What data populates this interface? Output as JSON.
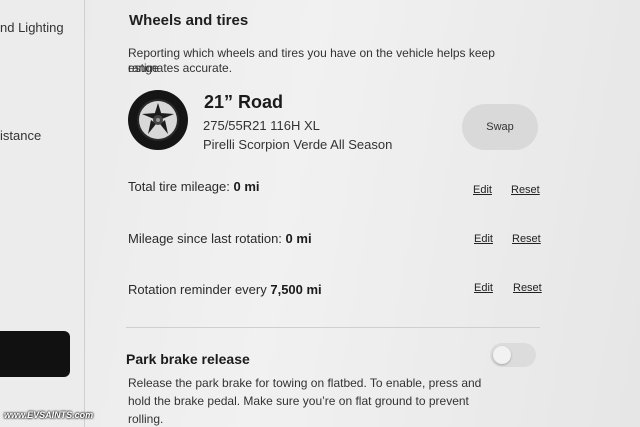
{
  "sidebar": {
    "items": [
      {
        "label": "nd Lighting"
      },
      {
        "label": "istance"
      }
    ]
  },
  "section": {
    "title": "Wheels and tires",
    "description_line1": "Reporting which wheels and tires you have on the vehicle helps keep range",
    "description_line2": "estimates accurate."
  },
  "tire": {
    "name": "21” Road",
    "size": "275/55R21 116H XL",
    "model": "Pirelli Scorpion Verde All Season",
    "swap_label": "Swap",
    "icon": "wheel-icon"
  },
  "rows": [
    {
      "label_prefix": "Total tire mileage:",
      "value": "0 mi",
      "edit": "Edit",
      "reset": "Reset"
    },
    {
      "label_prefix": "Mileage since last rotation:",
      "value": "0 mi",
      "edit": "Edit",
      "reset": "Reset"
    },
    {
      "label_prefix": "Rotation reminder every",
      "value": "7,500 mi",
      "edit": "Edit",
      "reset": "Reset"
    }
  ],
  "park_brake": {
    "title": "Park brake release",
    "desc_line1": "Release the park brake for towing on flatbed. To enable, press and",
    "desc_line2": "hold the brake pedal. Make sure you’re on flat ground to prevent",
    "desc_line3": "rolling.",
    "toggle_on": false
  },
  "watermark": "www.EVSAINTS.com"
}
